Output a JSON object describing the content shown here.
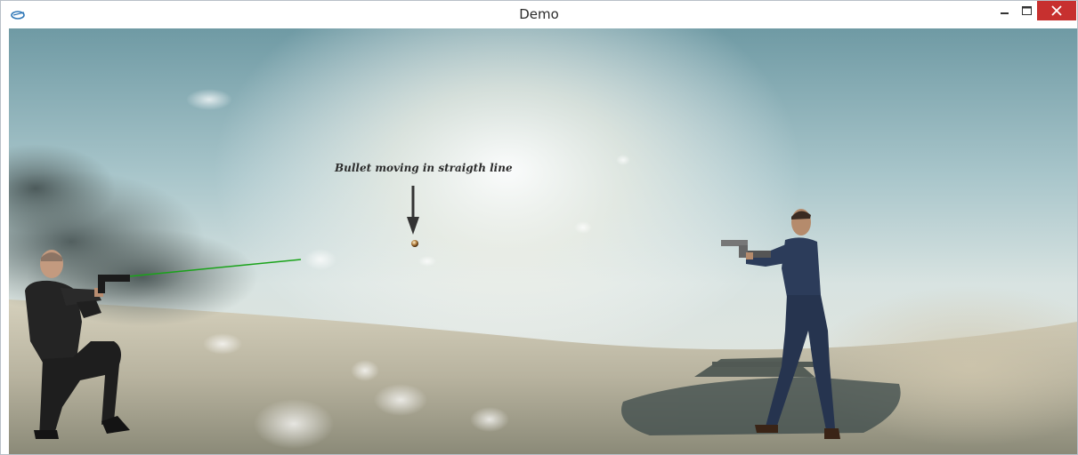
{
  "window": {
    "title": "Demo",
    "app_icon": "app-icon",
    "controls": {
      "minimize_icon": "minimize-icon",
      "maximize_icon": "maximize-icon",
      "close_icon": "close-icon"
    }
  },
  "scene": {
    "annotation_text": "Bullet moving in straigth line",
    "colors": {
      "laser": "#1aa31a",
      "sky": "#c9dde0",
      "ground": "#b9b4a0",
      "close_button": "#c7302f"
    }
  }
}
